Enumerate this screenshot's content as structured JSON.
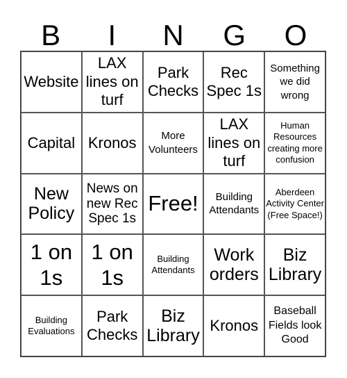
{
  "header": [
    "B",
    "I",
    "N",
    "G",
    "O"
  ],
  "cells": [
    {
      "text": "Website",
      "size": "s-m"
    },
    {
      "text": "LAX lines on turf",
      "size": "s-m"
    },
    {
      "text": "Park Checks",
      "size": "s-m"
    },
    {
      "text": "Rec Spec 1s",
      "size": "s-m"
    },
    {
      "text": "Something we did wrong",
      "size": "s-xs"
    },
    {
      "text": "Capital",
      "size": "s-m"
    },
    {
      "text": "Kronos",
      "size": "s-m"
    },
    {
      "text": "More Volunteers",
      "size": "s-xs"
    },
    {
      "text": "LAX lines on turf",
      "size": "s-m"
    },
    {
      "text": "Human Resources creating more confusion",
      "size": "s-xxs"
    },
    {
      "text": "New Policy",
      "size": "s-l"
    },
    {
      "text": "News on new Rec Spec 1s",
      "size": "s-ms"
    },
    {
      "text": "Free!",
      "size": "s-free"
    },
    {
      "text": "Building Attendants",
      "size": "s-xs"
    },
    {
      "text": "Aberdeen Activity Center (Free Space!)",
      "size": "s-xxs"
    },
    {
      "text": "1 on 1s",
      "size": "s-xl"
    },
    {
      "text": "1 on 1s",
      "size": "s-xl"
    },
    {
      "text": "Building Attendants",
      "size": "s-xxs"
    },
    {
      "text": "Work orders",
      "size": "s-l"
    },
    {
      "text": "Biz Library",
      "size": "s-l"
    },
    {
      "text": "Building Evaluations",
      "size": "s-xxs"
    },
    {
      "text": "Park Checks",
      "size": "s-m"
    },
    {
      "text": "Biz Library",
      "size": "s-l"
    },
    {
      "text": "Kronos",
      "size": "s-m"
    },
    {
      "text": "Baseball Fields look Good",
      "size": "s-s"
    }
  ]
}
